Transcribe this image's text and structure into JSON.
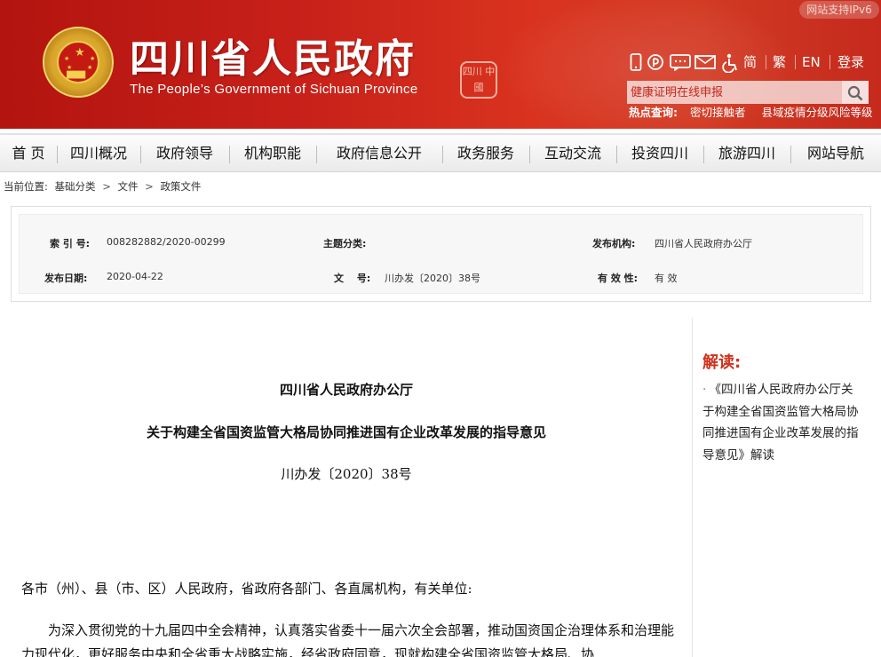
{
  "header": {
    "title": "四川省人民政府",
    "subtitle": "The People’s Government of Sichuan Province",
    "seal_text": "四川 中國",
    "ipv6_badge": "网站支持IPv6",
    "tools": {
      "icons": [
        "mobile-icon",
        "weibo-icon",
        "wechat-icon",
        "mail-icon",
        "accessibility-icon"
      ],
      "simplified": "简",
      "traditional": "繁",
      "english": "EN",
      "login": "登录"
    },
    "search": {
      "placeholder": "健康证明在线申报",
      "button_icon": "search-icon"
    },
    "hot": {
      "label": "热点查询:",
      "items": [
        "密切接触者",
        "县域疫情分级风险等级"
      ]
    }
  },
  "nav": {
    "items": [
      "首 页",
      "四川概况",
      "政府领导",
      "机构职能",
      "政府信息公开",
      "政务服务",
      "互动交流",
      "投资四川",
      "旅游四川",
      "网站导航"
    ]
  },
  "breadcrumb": {
    "label": "当前位置:",
    "items": [
      "基础分类",
      "文件",
      "政策文件"
    ],
    "separator": ">"
  },
  "meta": {
    "index_label": "索 引 号:",
    "index_value": "008282882/2020-00299",
    "topic_label": "主题分类:",
    "topic_value": "",
    "publisher_label": "发布机构:",
    "publisher_value": "四川省人民政府办公厅",
    "date_label": "发布日期:",
    "date_value": "2020-04-22",
    "docnum_label": "文　 号:",
    "docnum_value": "川办发〔2020〕38号",
    "validity_label": "有 效 性:",
    "validity_value": "有 效"
  },
  "article": {
    "issuer": "四川省人民政府办公厅",
    "title": "关于构建全省国资监管大格局协同推进国有企业改革发展的指导意见",
    "doc_number": "川办发〔2020〕38号",
    "salutation": "各市（州）、县（市、区）人民政府，省政府各部门、各直属机构，有关单位:",
    "body": "为深入贯彻党的十九届四中全会精神，认真落实省委十一届六次全会部署，推动国资国企治理体系和治理能力现代化，更好服务中央和全省重大战略实施，经省政府同意，现就构建全省国资监管大格局、协"
  },
  "sidebar": {
    "title": "解读:",
    "link_bullet": "·",
    "link_text": "《四川省人民政府办公厅关于构建全省国资监管大格局协同推进国有企业改革发展的指导意见》解读"
  },
  "colors": {
    "header_red": "#c8211a",
    "accent_red": "#d0311d",
    "nav_bg": "#eaeaea"
  }
}
